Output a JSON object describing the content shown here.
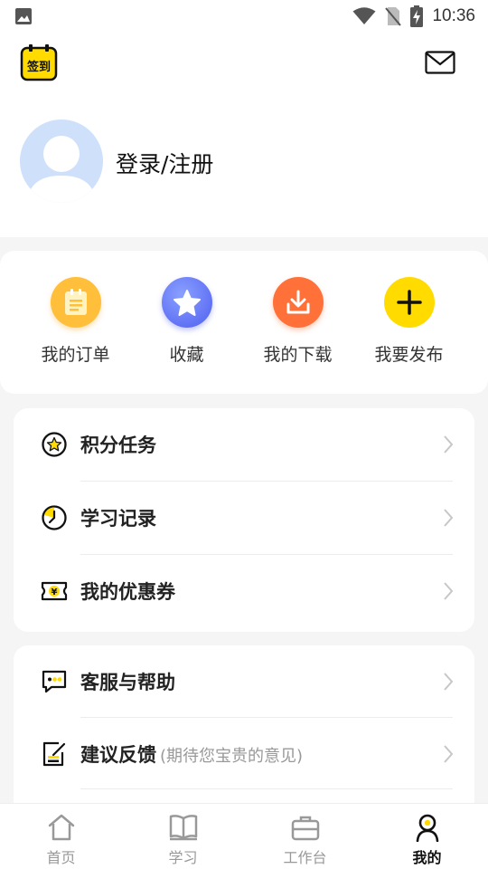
{
  "status_bar": {
    "time": "10:36"
  },
  "header": {
    "checkin_label": "签到",
    "login_text": "登录/注册"
  },
  "quick_actions": [
    {
      "label": "我的订单",
      "icon": "order-icon",
      "color": "#ffbf3a"
    },
    {
      "label": "收藏",
      "icon": "star-icon",
      "color": "#5b6ff2"
    },
    {
      "label": "我的下载",
      "icon": "download-icon",
      "color": "#ff7138"
    },
    {
      "label": "我要发布",
      "icon": "plus-icon",
      "color": "#ffdb00"
    }
  ],
  "menu_group_1": [
    {
      "label": "积分任务",
      "icon": "points-task-icon"
    },
    {
      "label": "学习记录",
      "icon": "study-record-icon"
    },
    {
      "label": "我的优惠券",
      "icon": "coupon-icon"
    }
  ],
  "menu_group_2": [
    {
      "label": "客服与帮助",
      "sub": "",
      "icon": "customer-service-icon"
    },
    {
      "label": "建议反馈",
      "sub": "(期待您宝贵的意见)",
      "icon": "feedback-icon"
    }
  ],
  "tab_bar": [
    {
      "label": "首页",
      "icon": "home-icon",
      "active": false
    },
    {
      "label": "学习",
      "icon": "book-icon",
      "active": false
    },
    {
      "label": "工作台",
      "icon": "briefcase-icon",
      "active": false
    },
    {
      "label": "我的",
      "icon": "profile-icon",
      "active": true
    }
  ],
  "colors": {
    "accent": "#ffdb00",
    "avatar_bg": "#cfe0fb"
  }
}
